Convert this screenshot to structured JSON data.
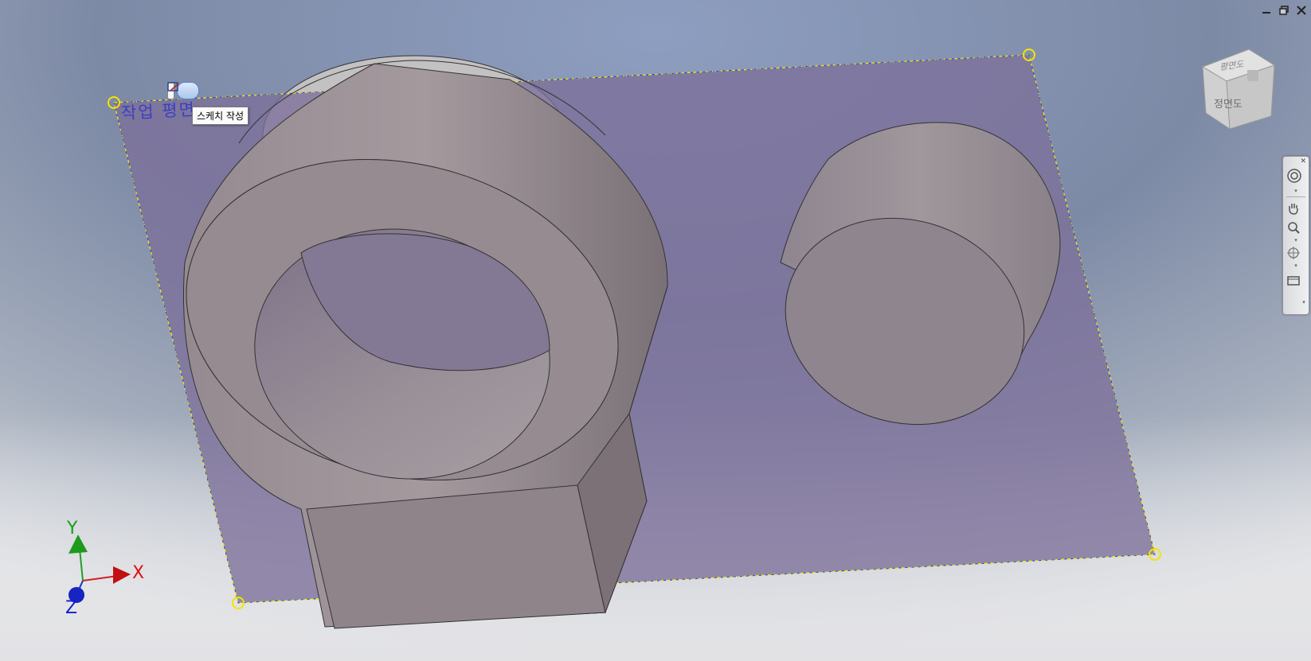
{
  "window": {
    "minimize_icon": "minimize-icon",
    "restore_icon": "restore-icon",
    "close_icon": "close-icon"
  },
  "viewcube": {
    "top_label": "평면도",
    "front_label": "정면도"
  },
  "workplane": {
    "label": "작업 평면",
    "tooltip": "스케치 작성"
  },
  "axes": {
    "x_label": "X",
    "y_label": "Y",
    "z_label": "Z",
    "x_color": "#e01010",
    "y_color": "#18a018",
    "z_color": "#1020c8"
  },
  "navbar": {
    "items": [
      "steering-wheel-icon",
      "pan-icon",
      "zoom-icon",
      "orbit-icon",
      "look-at-icon"
    ]
  },
  "colors": {
    "plane_fill": "#7c6f9a",
    "plane_border": "#f3e400",
    "part_face": "#a2989c",
    "bg_top": "#8a9ab8",
    "bg_bottom": "#d9d9dc"
  }
}
